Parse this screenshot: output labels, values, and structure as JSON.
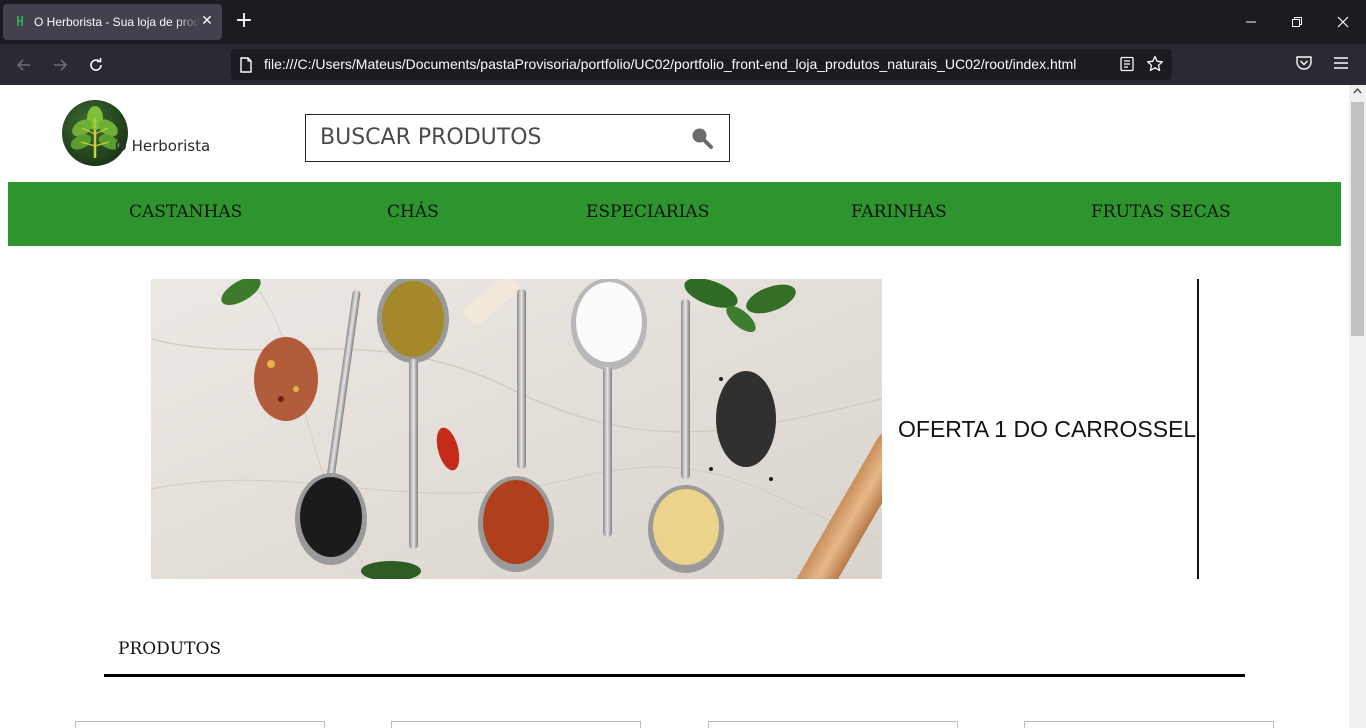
{
  "browser": {
    "tab_title": "O Herborista - Sua loja de produtos naturais",
    "favicon_letter": "H",
    "new_tab_symbol": "+",
    "close_symbol": "✕",
    "url": "file:///C:/Users/Mateus/Documents/pastaProvisoria/portfolio/UC02/portfolio_front-end_loja_produtos_naturais_UC02/root/index.html"
  },
  "header": {
    "logo_text": "O Herborista",
    "search_placeholder": "BUSCAR PRODUTOS"
  },
  "menu": {
    "items": [
      "CASTANHAS",
      "CHÁS",
      "ESPECIARIAS",
      "FARINHAS",
      "FRUTAS SECAS"
    ]
  },
  "carousel": {
    "caption": "OFERTA 1 DO CARROSSEL"
  },
  "products": {
    "title": "PRODUTOS"
  },
  "colors": {
    "menu_bar": "#2e952e",
    "tab_bar": "#1c1b22",
    "nav_bar": "#2b2a33"
  }
}
